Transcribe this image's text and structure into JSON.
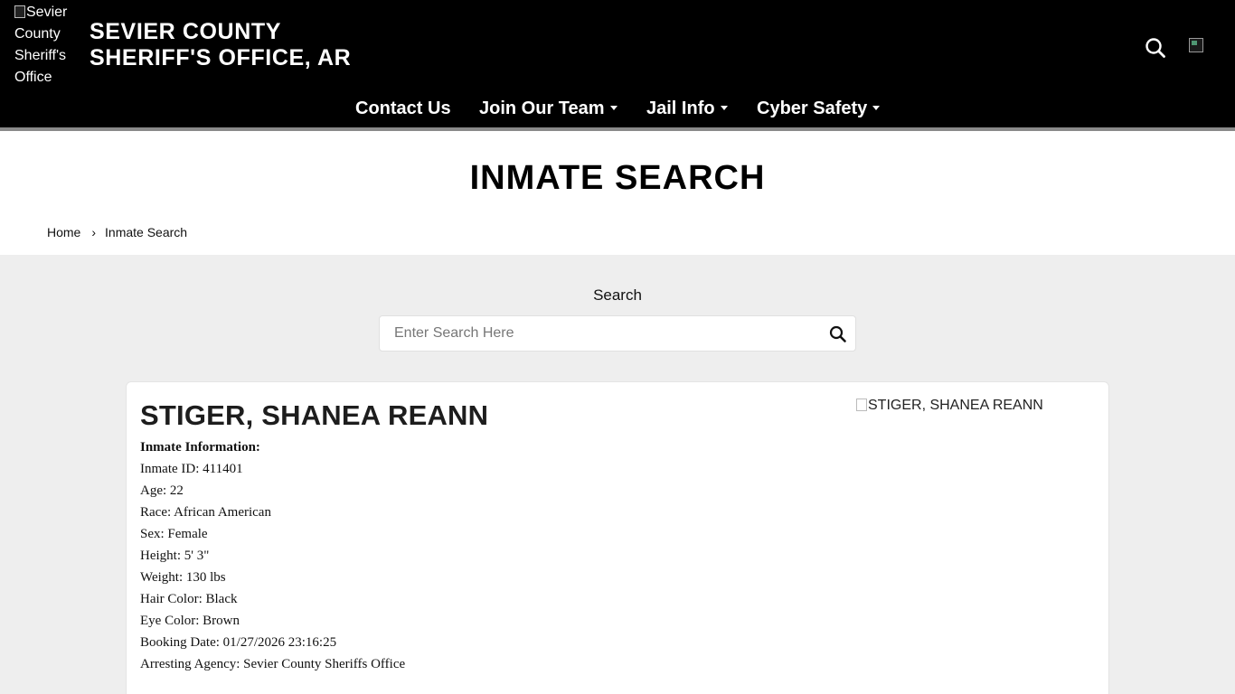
{
  "header": {
    "logo_alt": "Sevier County Sheriff's Office",
    "title_line1": "SEVIER COUNTY",
    "title_line2": "SHERIFF'S OFFICE, AR",
    "search_icon": "search-icon",
    "image_icon": "broken-image-icon"
  },
  "nav": {
    "items": [
      {
        "label": "Contact Us",
        "dropdown": false
      },
      {
        "label": "Join Our Team",
        "dropdown": true
      },
      {
        "label": "Jail Info",
        "dropdown": true
      },
      {
        "label": "Cyber Safety",
        "dropdown": true
      }
    ]
  },
  "page": {
    "title": "INMATE SEARCH",
    "breadcrumb": {
      "home": "Home",
      "separator": "›",
      "current": "Inmate Search"
    }
  },
  "search": {
    "label": "Search",
    "placeholder": "Enter Search Here",
    "value": ""
  },
  "inmate": {
    "name": "STIGER, SHANEA REANN",
    "photo_alt": "STIGER, SHANEA REANN",
    "info_heading": "Inmate Information:",
    "fields": [
      {
        "label": "Inmate ID:",
        "value": "411401"
      },
      {
        "label": "Age:",
        "value": "22"
      },
      {
        "label": "Race:",
        "value": "African American"
      },
      {
        "label": "Sex:",
        "value": "Female"
      },
      {
        "label": "Height:",
        "value": "5' 3\""
      },
      {
        "label": "Weight:",
        "value": "130 lbs"
      },
      {
        "label": "Hair Color:",
        "value": "Black"
      },
      {
        "label": "Eye Color:",
        "value": "Brown"
      },
      {
        "label": "Booking Date:",
        "value": "01/27/2026 23:16:25"
      },
      {
        "label": "Arresting Agency:",
        "value": "Sevier County Sheriffs Office"
      }
    ]
  },
  "colors": {
    "header_bg": "#000000",
    "header_rule": "#8a8a8a",
    "content_bg": "#eeeeee",
    "card_bg": "#ffffff"
  }
}
